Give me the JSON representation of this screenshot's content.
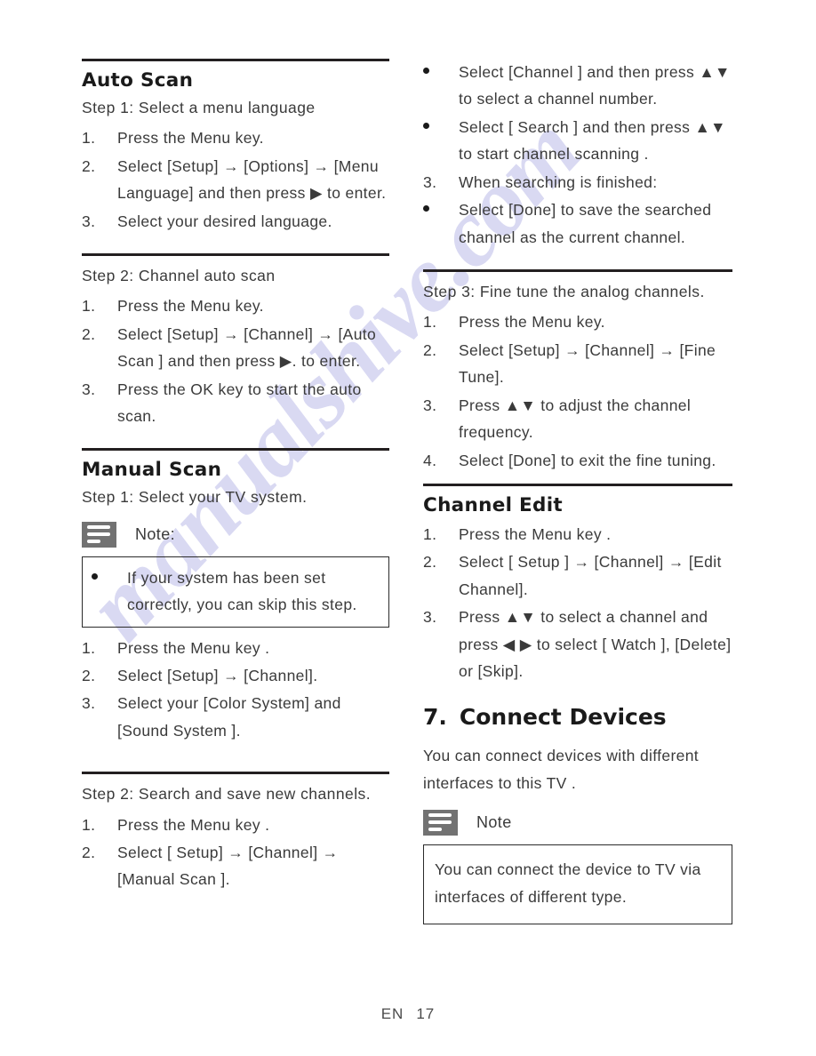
{
  "page": {
    "language_code": "EN",
    "page_number": "17",
    "watermark": "manualshive.com",
    "watermark_color": "#d9d9f2",
    "note_icon_color": "#727272"
  },
  "left_column": {
    "auto_scan": {
      "title": "Auto Scan",
      "step1_heading": "Step 1:  Select a menu language",
      "step1_items": [
        {
          "marker": "1.",
          "text": "Press the Menu key."
        },
        {
          "marker": "2.",
          "text": "Select [Setup] → [Options] → [Menu Language] and then press ▶ to enter."
        },
        {
          "marker": "3.",
          "text": "Select your desired language."
        }
      ],
      "step2_heading": "Step 2: Channel auto scan",
      "step2_items": [
        {
          "marker": "1.",
          "text": "Press the Menu key."
        },
        {
          "marker": "2.",
          "text": "Select [Setup] → [Channel] → [Auto Scan ] and then press ▶. to enter."
        },
        {
          "marker": "3.",
          "text": "Press the OK key to start the auto scan."
        }
      ]
    },
    "manual_scan": {
      "title": "Manual Scan",
      "step1_heading": "Step 1:  Select your TV system.",
      "note_label": "Note:",
      "note_bullets": [
        {
          "marker": "•",
          "text": "If your system has been set correctly, you can skip this step."
        }
      ],
      "step1_items": [
        {
          "marker": "1.",
          "text": "Press the Menu key ."
        },
        {
          "marker": "2.",
          "text": "Select [Setup] → [Channel]."
        },
        {
          "marker": "3.",
          "text": "Select your [Color System] and [Sound System ]."
        }
      ],
      "step2_heading": "Step 2:  Search and save new channels.",
      "step2_items": [
        {
          "marker": "1.",
          "text": "Press the Menu key ."
        },
        {
          "marker": "2.",
          "text": "Select [ Setup] → [Channel] → [Manual Scan ]."
        }
      ]
    }
  },
  "right_column": {
    "manual_scan_cont": {
      "bullets": [
        {
          "marker": "•",
          "text": "Select [Channel ] and then press ▲▼ to select a channel number."
        },
        {
          "marker": "•",
          "text": "Select [ Search ] and then press ▲▼ to start channel scanning ."
        }
      ],
      "numbered": [
        {
          "marker": "3.",
          "text": "When searching is finished:"
        }
      ],
      "bullets_after": [
        {
          "marker": "•",
          "text": "Select [Done] to save the searched channel as the current channel."
        }
      ]
    },
    "fine_tune": {
      "heading": "Step 3:  Fine tune the analog channels.",
      "items": [
        {
          "marker": "1.",
          "text": "Press the Menu key."
        },
        {
          "marker": "2.",
          "text": "Select [Setup] → [Channel] → [Fine Tune]."
        },
        {
          "marker": "3.",
          "text": "Press ▲▼ to adjust the channel frequency."
        },
        {
          "marker": "4.",
          "text": "Select [Done] to exit the fine tuning."
        }
      ]
    },
    "channel_edit": {
      "title": "Channel Edit",
      "items": [
        {
          "marker": "1.",
          "text": "Press the Menu key ."
        },
        {
          "marker": "2.",
          "text": "Select [ Setup ] → [Channel] → [Edit Channel]."
        },
        {
          "marker": "3.",
          "text": "Press ▲▼ to select a channel and press ◀ ▶ to select [ Watch ],  [Delete] or [Skip]."
        }
      ]
    },
    "connect_devices": {
      "number": "7.",
      "title": "Connect Devices",
      "intro": "You can connect devices with different interfaces to this TV .",
      "note_label": "Note",
      "note_text": "You can connect the device to TV via interfaces of different type."
    }
  }
}
